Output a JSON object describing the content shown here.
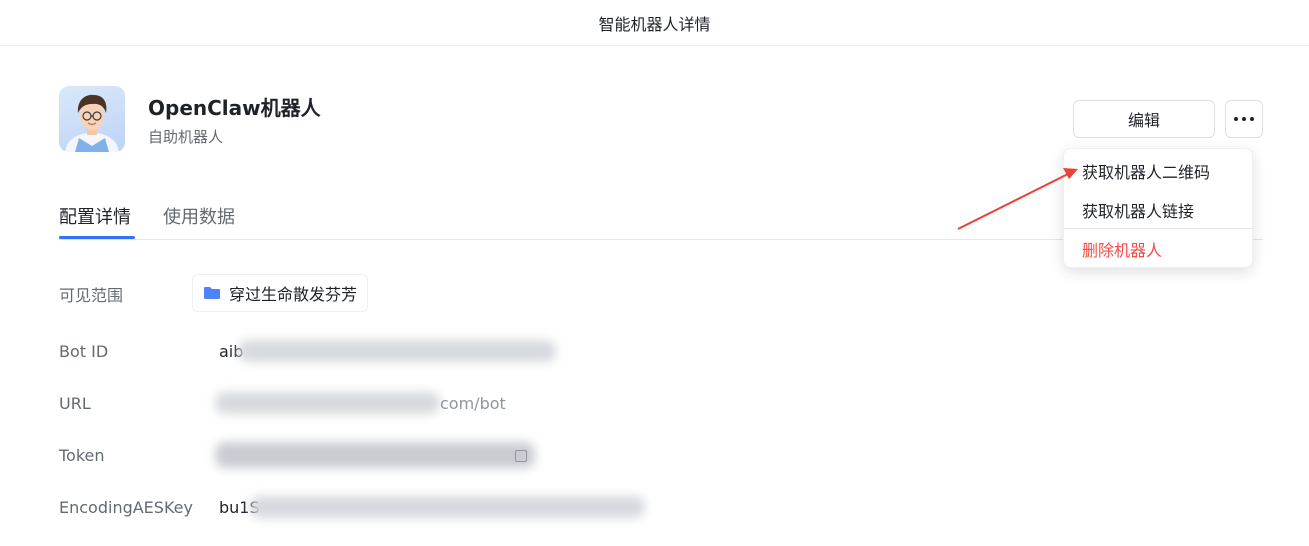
{
  "header": {
    "title": "智能机器人详情"
  },
  "bot": {
    "name": "OpenClaw机器人",
    "type": "自助机器人"
  },
  "actions": {
    "edit_label": "编辑"
  },
  "tabs": [
    {
      "label": "配置详情",
      "active": true
    },
    {
      "label": "使用数据",
      "active": false
    }
  ],
  "details": {
    "scope": {
      "label": "可见范围",
      "value": "穿过生命散发芬芳"
    },
    "bot_id": {
      "label": "Bot ID",
      "value_prefix": "aib"
    },
    "url": {
      "label": "URL",
      "value_suffix": "com/bot"
    },
    "token": {
      "label": "Token"
    },
    "aes_key": {
      "label": "EncodingAESKey",
      "value_prefix": "bu1S"
    }
  },
  "menu": {
    "items": [
      {
        "label": "获取机器人二维码",
        "color": "#1f2329"
      },
      {
        "label": "获取机器人链接",
        "color": "#1f2329"
      },
      {
        "label": "删除机器人",
        "color": "#f54a45"
      }
    ]
  },
  "colors": {
    "accent": "#3370ff",
    "danger": "#f54a45",
    "arrow": "#e8423a",
    "folder": "#4e83fd"
  }
}
